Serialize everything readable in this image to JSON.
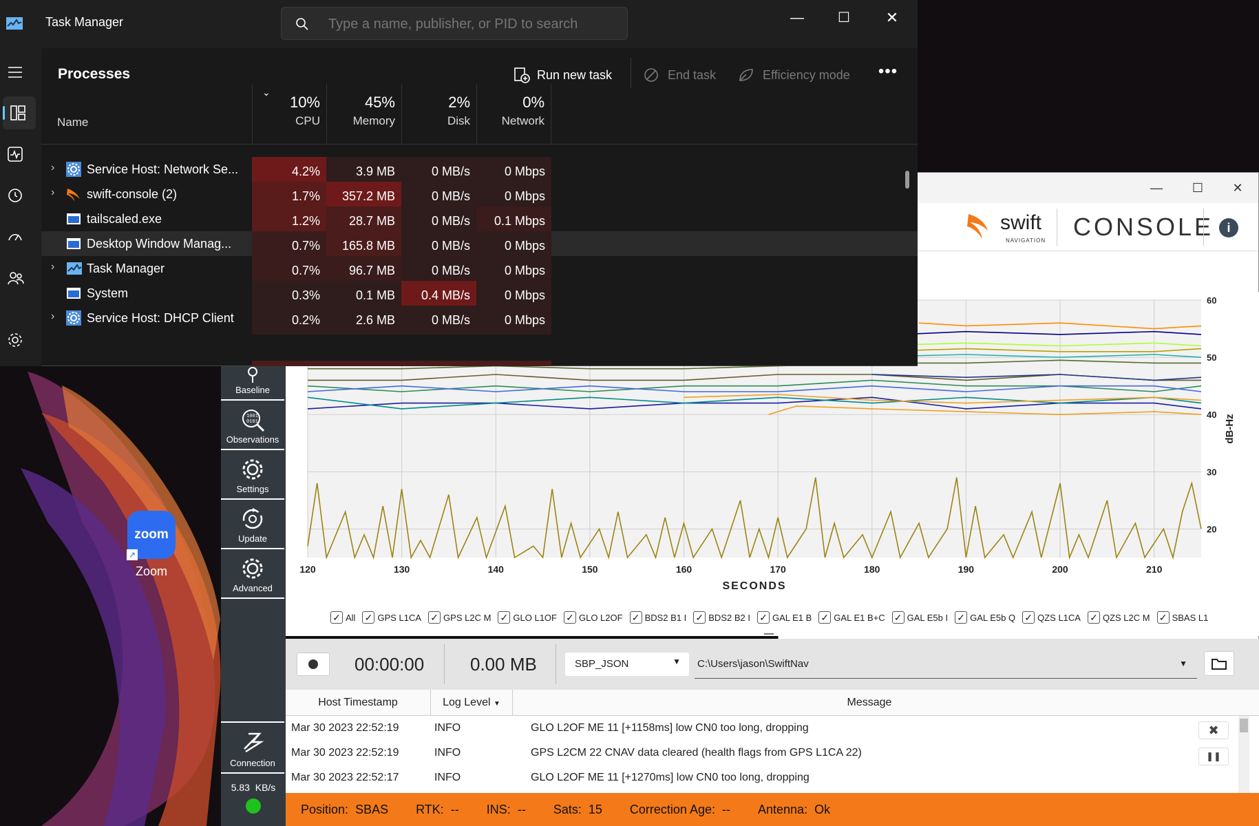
{
  "task_manager": {
    "title": "Task Manager",
    "search_placeholder": "Type a name, publisher, or PID to search",
    "section_title": "Processes",
    "toolbar": {
      "run_new_task": "Run new task",
      "end_task": "End task",
      "efficiency_mode": "Efficiency mode"
    },
    "columns": {
      "name": "Name",
      "cpu_pct": "10%",
      "cpu": "CPU",
      "memory_pct": "45%",
      "memory": "Memory",
      "disk_pct": "2%",
      "disk": "Disk",
      "network_pct": "0%",
      "network": "Network"
    },
    "rows": [
      {
        "name": "Service Host: Network Se...",
        "cpu": "4.2%",
        "memory": "3.9 MB",
        "disk": "0 MB/s",
        "network": "0 Mbps",
        "expandable": true,
        "icon": "gear-icon"
      },
      {
        "name": "swift-console (2)",
        "cpu": "1.7%",
        "memory": "357.2 MB",
        "disk": "0 MB/s",
        "network": "0 Mbps",
        "expandable": true,
        "icon": "swift-icon"
      },
      {
        "name": "tailscaled.exe",
        "cpu": "1.2%",
        "memory": "28.7 MB",
        "disk": "0 MB/s",
        "network": "0.1 Mbps",
        "expandable": false,
        "icon": "window-icon"
      },
      {
        "name": "Desktop Window Manag...",
        "cpu": "0.7%",
        "memory": "165.8 MB",
        "disk": "0 MB/s",
        "network": "0 Mbps",
        "expandable": false,
        "icon": "window-icon"
      },
      {
        "name": "Task Manager",
        "cpu": "0.7%",
        "memory": "96.7 MB",
        "disk": "0 MB/s",
        "network": "0 Mbps",
        "expandable": true,
        "icon": "taskmgr-icon"
      },
      {
        "name": "System",
        "cpu": "0.3%",
        "memory": "0.1 MB",
        "disk": "0.4 MB/s",
        "network": "0 Mbps",
        "expandable": false,
        "icon": "window-icon"
      },
      {
        "name": "Service Host: DHCP Client",
        "cpu": "0.2%",
        "memory": "2.6 MB",
        "disk": "0 MB/s",
        "network": "0 Mbps",
        "expandable": true,
        "icon": "gear-icon"
      }
    ],
    "colors": {
      "bg": "#1f1f1f",
      "heat_high": "#6e1a1a",
      "heat_mid": "#4a1c1c",
      "heat_low": "#2f1c1c"
    }
  },
  "swift": {
    "brand": "swift",
    "brand_sub": "NAVIGATION",
    "title": "CONSOLE",
    "nav": [
      {
        "label": "Baseline",
        "icon": "baseline-icon"
      },
      {
        "label": "Observations",
        "icon": "observations-icon"
      },
      {
        "label": "Settings",
        "icon": "gear-icon"
      },
      {
        "label": "Update",
        "icon": "update-icon"
      },
      {
        "label": "Advanced",
        "icon": "advanced-gear-icon"
      }
    ],
    "connection_label": "Connection",
    "data_rate": "5.83  KB/s",
    "legend": [
      "All",
      "GPS L1CA",
      "GPS L2C M",
      "GLO L1OF",
      "GLO L2OF",
      "BDS2 B1 I",
      "BDS2 B2 I",
      "GAL E1 B",
      "GAL E1 B+C",
      "GAL E5b I",
      "GAL E5b Q",
      "QZS L1CA",
      "QZS L2C M",
      "SBAS L1"
    ],
    "recording": {
      "time": "00:00:00",
      "size": "0.00 MB",
      "format": "SBP_JSON",
      "path": "C:\\Users\\jason\\SwiftNav"
    },
    "log": {
      "headers": {
        "timestamp": "Host Timestamp",
        "level": "Log Level",
        "message": "Message"
      },
      "rows": [
        {
          "ts": "Mar 30 2023 22:52:19",
          "level": "INFO",
          "msg": "GLO L2OF ME 11 [+1158ms] low CN0 too long, dropping"
        },
        {
          "ts": "Mar 30 2023 22:52:19",
          "level": "INFO",
          "msg": "GPS L2CM 22 CNAV data cleared (health flags from GPS L1CA 22)"
        },
        {
          "ts": "Mar 30 2023 22:52:17",
          "level": "INFO",
          "msg": "GLO L2OF ME 11 [+1270ms] low CN0 too long, dropping"
        }
      ]
    },
    "status": {
      "position_label": "Position:",
      "position": "SBAS",
      "rtk_label": "RTK:",
      "rtk": "--",
      "ins_label": "INS:",
      "ins": "--",
      "sats_label": "Sats:",
      "sats": "15",
      "corr_label": "Correction Age:",
      "corr": "--",
      "antenna_label": "Antenna:",
      "antenna": "Ok"
    },
    "accent": "#f47a19"
  },
  "desktop": {
    "zoom_label": "Zoom",
    "zoom_icon_text": "zoom"
  },
  "chart_data": {
    "type": "line",
    "xlabel": "SECONDS",
    "ylabel": "dB-Hz",
    "xlim": [
      120,
      215
    ],
    "ylim": [
      15,
      60
    ],
    "x_ticks": [
      120,
      130,
      140,
      150,
      160,
      170,
      180,
      190,
      200,
      210
    ],
    "y_ticks": [
      20,
      30,
      40,
      50,
      60
    ],
    "grid": true,
    "series": [
      {
        "color": "#1a1aa0",
        "values": [
          [
            120,
            41
          ],
          [
            130,
            42
          ],
          [
            140,
            42
          ],
          [
            150,
            41
          ],
          [
            160,
            42
          ],
          [
            170,
            42
          ],
          [
            180,
            43
          ],
          [
            190,
            41
          ],
          [
            200,
            42
          ],
          [
            210,
            42
          ],
          [
            215,
            41
          ]
        ]
      },
      {
        "color": "#008b8b",
        "values": [
          [
            120,
            43
          ],
          [
            130,
            41
          ],
          [
            140,
            42
          ],
          [
            150,
            43
          ],
          [
            160,
            42
          ],
          [
            170,
            43
          ],
          [
            180,
            42
          ],
          [
            190,
            43
          ],
          [
            200,
            42
          ],
          [
            210,
            43
          ],
          [
            215,
            42
          ]
        ]
      },
      {
        "color": "#2e8b57",
        "values": [
          [
            120,
            45
          ],
          [
            130,
            44
          ],
          [
            140,
            45
          ],
          [
            150,
            44
          ],
          [
            160,
            45
          ],
          [
            170,
            45
          ],
          [
            180,
            46
          ],
          [
            190,
            45
          ],
          [
            200,
            45
          ],
          [
            210,
            44
          ],
          [
            215,
            45
          ]
        ]
      },
      {
        "color": "#6b5a2e",
        "values": [
          [
            120,
            46
          ],
          [
            130,
            46
          ],
          [
            140,
            47
          ],
          [
            150,
            46
          ],
          [
            160,
            46
          ],
          [
            170,
            47
          ],
          [
            180,
            47
          ],
          [
            190,
            46
          ],
          [
            200,
            47
          ],
          [
            210,
            46
          ],
          [
            215,
            46
          ]
        ]
      },
      {
        "color": "#4169e1",
        "values": [
          [
            120,
            44
          ],
          [
            130,
            45
          ],
          [
            140,
            44
          ],
          [
            150,
            45
          ],
          [
            160,
            44
          ],
          [
            170,
            44
          ],
          [
            180,
            45
          ],
          [
            190,
            44
          ],
          [
            200,
            45
          ],
          [
            210,
            45
          ],
          [
            215,
            44
          ]
        ]
      },
      {
        "color": "#f0a020",
        "values": [
          [
            169,
            40
          ],
          [
            172,
            41.5
          ],
          [
            180,
            41
          ],
          [
            190,
            40.5
          ],
          [
            200,
            40
          ],
          [
            210,
            40.5
          ],
          [
            215,
            40
          ]
        ]
      },
      {
        "color": "#f0a020",
        "values": [
          [
            160,
            43
          ],
          [
            170,
            43.5
          ],
          [
            180,
            42.5
          ],
          [
            190,
            42
          ],
          [
            200,
            42.5
          ],
          [
            210,
            43
          ],
          [
            215,
            42.5
          ]
        ]
      },
      {
        "color": "#adff2f",
        "values": [
          [
            180,
            52
          ],
          [
            190,
            52.5
          ],
          [
            200,
            52
          ],
          [
            210,
            52.5
          ],
          [
            215,
            52
          ]
        ]
      },
      {
        "color": "#ff8c00",
        "values": [
          [
            185,
            56
          ],
          [
            190,
            55.5
          ],
          [
            200,
            56
          ],
          [
            210,
            55
          ],
          [
            215,
            55.5
          ]
        ]
      },
      {
        "color": "#00008b",
        "values": [
          [
            183,
            54
          ],
          [
            190,
            54.5
          ],
          [
            200,
            54
          ],
          [
            210,
            54.5
          ],
          [
            215,
            54
          ]
        ]
      },
      {
        "color": "#556b2f",
        "values": [
          [
            120,
            48
          ],
          [
            130,
            48
          ],
          [
            140,
            48.5
          ],
          [
            150,
            48
          ],
          [
            160,
            48
          ],
          [
            170,
            48.5
          ],
          [
            180,
            49
          ],
          [
            190,
            49
          ],
          [
            200,
            49.5
          ],
          [
            210,
            49
          ],
          [
            215,
            49
          ]
        ]
      },
      {
        "color": "#20b2aa",
        "values": [
          [
            178,
            50
          ],
          [
            190,
            50.5
          ],
          [
            200,
            50
          ],
          [
            210,
            50.5
          ],
          [
            215,
            50
          ]
        ]
      },
      {
        "color": "#b8a000",
        "values": [
          [
            180,
            51
          ],
          [
            190,
            51.5
          ],
          [
            200,
            51
          ],
          [
            210,
            51
          ],
          [
            215,
            51.5
          ]
        ]
      },
      {
        "color": "#1e3a8a",
        "values": [
          [
            180,
            47
          ],
          [
            190,
            46.5
          ],
          [
            200,
            47
          ],
          [
            210,
            46
          ],
          [
            215,
            46.5
          ]
        ]
      },
      {
        "color": "#9b8514",
        "values": [
          [
            120,
            17
          ],
          [
            121,
            28
          ],
          [
            122,
            15
          ],
          [
            124,
            23
          ],
          [
            125,
            15
          ],
          [
            126,
            19
          ],
          [
            127,
            15
          ],
          [
            128,
            24
          ],
          [
            129,
            15
          ],
          [
            130,
            27
          ],
          [
            131,
            15
          ],
          [
            132,
            18
          ],
          [
            133,
            15
          ],
          [
            135,
            26
          ],
          [
            136,
            15
          ],
          [
            138,
            22
          ],
          [
            139,
            15
          ],
          [
            141,
            24
          ],
          [
            142,
            15
          ],
          [
            144,
            17
          ],
          [
            145,
            15
          ],
          [
            146,
            27
          ],
          [
            147,
            15
          ],
          [
            148,
            21
          ],
          [
            149,
            15
          ],
          [
            151,
            20
          ],
          [
            152,
            15
          ],
          [
            153,
            23
          ],
          [
            154,
            15
          ],
          [
            156,
            19
          ],
          [
            157,
            15
          ],
          [
            158,
            22
          ],
          [
            159,
            15
          ],
          [
            160,
            21
          ],
          [
            161,
            15
          ],
          [
            163,
            20
          ],
          [
            164,
            15
          ],
          [
            166,
            25
          ],
          [
            167,
            15
          ],
          [
            168,
            20
          ],
          [
            169,
            15
          ],
          [
            170,
            22
          ],
          [
            171,
            15
          ],
          [
            173,
            20
          ],
          [
            174,
            29
          ],
          [
            175,
            15
          ],
          [
            176,
            21
          ],
          [
            177,
            15
          ],
          [
            179,
            19
          ],
          [
            180,
            15
          ],
          [
            182,
            23
          ],
          [
            183,
            15
          ],
          [
            185,
            21
          ],
          [
            186,
            15
          ],
          [
            188,
            20
          ],
          [
            189,
            29
          ],
          [
            190,
            15
          ],
          [
            191,
            24
          ],
          [
            192,
            15
          ],
          [
            194,
            19
          ],
          [
            195,
            15
          ],
          [
            197,
            23
          ],
          [
            198,
            15
          ],
          [
            200,
            28
          ],
          [
            201,
            15
          ],
          [
            202,
            19
          ],
          [
            203,
            15
          ],
          [
            205,
            25
          ],
          [
            206,
            15
          ],
          [
            208,
            21
          ],
          [
            209,
            15
          ],
          [
            211,
            20
          ],
          [
            212,
            15
          ],
          [
            213,
            23
          ],
          [
            214,
            28
          ],
          [
            215,
            20
          ]
        ]
      }
    ]
  }
}
